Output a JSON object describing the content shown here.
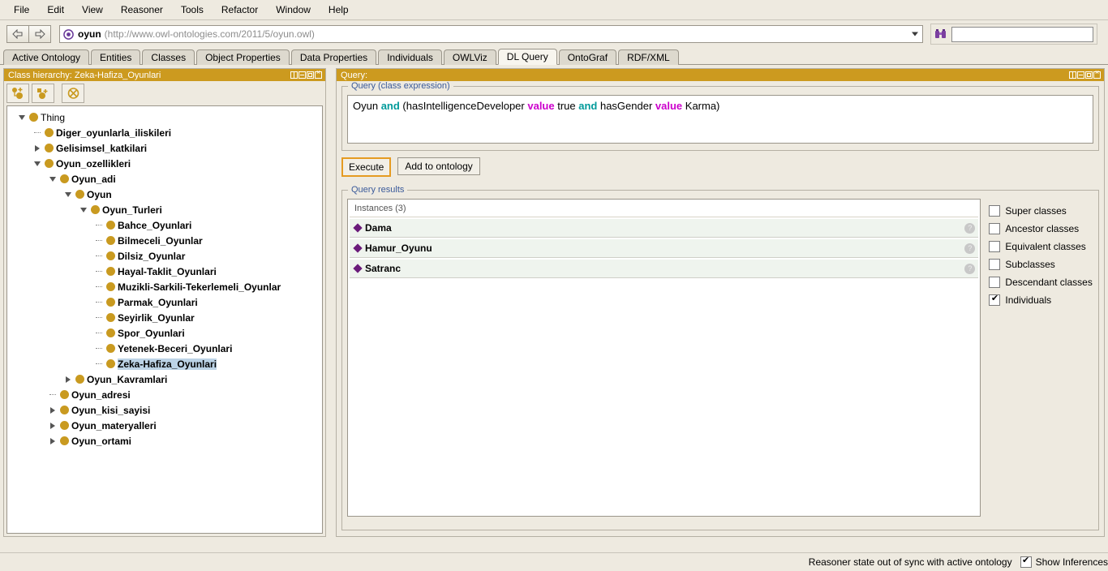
{
  "menu": {
    "items": [
      "File",
      "Edit",
      "View",
      "Reasoner",
      "Tools",
      "Refactor",
      "Window",
      "Help"
    ]
  },
  "toolbar": {
    "back_icon": "back-arrow-icon",
    "forward_icon": "forward-arrow-icon",
    "ontology_name": "oyun",
    "ontology_iri": "(http://www.owl-ontologies.com/2011/5/oyun.owl)",
    "search_icon": "binoculars-icon",
    "search_value": "",
    "search_placeholder": ""
  },
  "tabs": [
    {
      "label": "Active Ontology",
      "active": false
    },
    {
      "label": "Entities",
      "active": false
    },
    {
      "label": "Classes",
      "active": false
    },
    {
      "label": "Object Properties",
      "active": false
    },
    {
      "label": "Data Properties",
      "active": false
    },
    {
      "label": "Individuals",
      "active": false
    },
    {
      "label": "OWLViz",
      "active": false
    },
    {
      "label": "DL Query",
      "active": true
    },
    {
      "label": "OntoGraf",
      "active": false
    },
    {
      "label": "RDF/XML",
      "active": false
    }
  ],
  "class_hierarchy": {
    "title": "Class hierarchy: Zeka-Hafiza_Oyunlari",
    "tools": [
      {
        "name": "add-subclass-icon",
        "label": "Add subclass"
      },
      {
        "name": "add-sibling-class-icon",
        "label": "Add sibling class"
      },
      {
        "name": "delete-class-icon",
        "label": "Delete class"
      }
    ],
    "tree": [
      {
        "label": "Thing",
        "depth": 0,
        "twisty": "down",
        "bold": false,
        "selected": false
      },
      {
        "label": "Diger_oyunlarla_iliskileri",
        "depth": 1,
        "twisty": "none",
        "bold": true,
        "selected": false
      },
      {
        "label": "Gelisimsel_katkilari",
        "depth": 1,
        "twisty": "right",
        "bold": true,
        "selected": false
      },
      {
        "label": "Oyun_ozellikleri",
        "depth": 1,
        "twisty": "down",
        "bold": true,
        "selected": false
      },
      {
        "label": "Oyun_adi",
        "depth": 2,
        "twisty": "down",
        "bold": true,
        "selected": false
      },
      {
        "label": "Oyun",
        "depth": 3,
        "twisty": "down",
        "bold": true,
        "selected": false
      },
      {
        "label": "Oyun_Turleri",
        "depth": 4,
        "twisty": "down",
        "bold": true,
        "selected": false
      },
      {
        "label": "Bahce_Oyunlari",
        "depth": 5,
        "twisty": "none",
        "bold": true,
        "selected": false
      },
      {
        "label": "Bilmeceli_Oyunlar",
        "depth": 5,
        "twisty": "none",
        "bold": true,
        "selected": false
      },
      {
        "label": "Dilsiz_Oyunlar",
        "depth": 5,
        "twisty": "none",
        "bold": true,
        "selected": false
      },
      {
        "label": "Hayal-Taklit_Oyunlari",
        "depth": 5,
        "twisty": "none",
        "bold": true,
        "selected": false
      },
      {
        "label": "Muzikli-Sarkili-Tekerlemeli_Oyunlar",
        "depth": 5,
        "twisty": "none",
        "bold": true,
        "selected": false
      },
      {
        "label": "Parmak_Oyunlari",
        "depth": 5,
        "twisty": "none",
        "bold": true,
        "selected": false
      },
      {
        "label": "Seyirlik_Oyunlar",
        "depth": 5,
        "twisty": "none",
        "bold": true,
        "selected": false
      },
      {
        "label": "Spor_Oyunlari",
        "depth": 5,
        "twisty": "none",
        "bold": true,
        "selected": false
      },
      {
        "label": "Yetenek-Beceri_Oyunlari",
        "depth": 5,
        "twisty": "none",
        "bold": true,
        "selected": false
      },
      {
        "label": "Zeka-Hafiza_Oyunlari",
        "depth": 5,
        "twisty": "none",
        "bold": true,
        "selected": true
      },
      {
        "label": "Oyun_Kavramlari",
        "depth": 3,
        "twisty": "right",
        "bold": true,
        "selected": false
      },
      {
        "label": "Oyun_adresi",
        "depth": 2,
        "twisty": "none",
        "bold": true,
        "selected": false
      },
      {
        "label": "Oyun_kisi_sayisi",
        "depth": 2,
        "twisty": "right",
        "bold": true,
        "selected": false
      },
      {
        "label": "Oyun_materyalleri",
        "depth": 2,
        "twisty": "right",
        "bold": true,
        "selected": false
      },
      {
        "label": "Oyun_ortami",
        "depth": 2,
        "twisty": "right",
        "bold": true,
        "selected": false
      }
    ]
  },
  "query_panel": {
    "title": "Query:",
    "expression_legend": "Query (class expression)",
    "expression_tokens": [
      {
        "text": "Oyun ",
        "kind": "plain"
      },
      {
        "text": "and",
        "kind": "and"
      },
      {
        "text": " (hasIntelligenceDeveloper ",
        "kind": "plain"
      },
      {
        "text": "value",
        "kind": "value"
      },
      {
        "text": " true ",
        "kind": "plain"
      },
      {
        "text": "and",
        "kind": "and"
      },
      {
        "text": " hasGender ",
        "kind": "plain"
      },
      {
        "text": "value",
        "kind": "value"
      },
      {
        "text": " Karma)",
        "kind": "plain"
      }
    ],
    "execute_label": "Execute",
    "add_to_ontology_label": "Add to ontology",
    "results_legend": "Query results",
    "results_header": "Instances (3)",
    "results": [
      {
        "name": "Dama",
        "help": "?"
      },
      {
        "name": "Hamur_Oyunu",
        "help": "?"
      },
      {
        "name": "Satranc",
        "help": "?"
      }
    ],
    "options": [
      {
        "label": "Super classes",
        "checked": false
      },
      {
        "label": "Ancestor classes",
        "checked": false
      },
      {
        "label": "Equivalent classes",
        "checked": false
      },
      {
        "label": "Subclasses",
        "checked": false
      },
      {
        "label": "Descendant classes",
        "checked": false
      },
      {
        "label": "Individuals",
        "checked": true
      }
    ]
  },
  "statusbar": {
    "reasoner_text": "Reasoner state out of sync with active ontology",
    "show_inferences_label": "Show Inferences",
    "show_inferences_checked": true
  },
  "colors": {
    "panel_title": "#cc9a1f",
    "class_dot": "#c99a20",
    "individual_diamond": "#6a1b7a",
    "keyword_and": "#009a9a",
    "keyword_value": "#cc00cc",
    "selection": "#bcd3e6",
    "focus_border": "#e59b22",
    "background": "#eeeae0"
  }
}
